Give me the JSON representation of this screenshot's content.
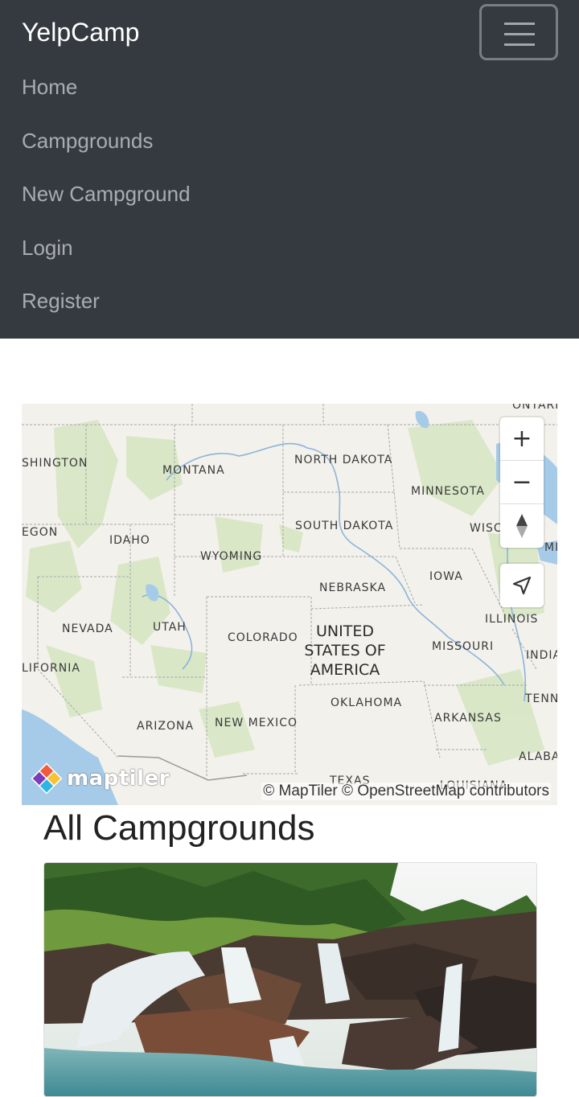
{
  "navbar": {
    "brand": "YelpCamp",
    "links": [
      "Home",
      "Campgrounds",
      "New Campground",
      "Login",
      "Register"
    ]
  },
  "map": {
    "states": {
      "washington": "SHINGTON",
      "montana": "MONTANA",
      "north_dakota": "NORTH DAKOTA",
      "minnesota": "MINNESOTA",
      "oregon": "EGON",
      "idaho": "IDAHO",
      "south_dakota": "SOUTH DAKOTA",
      "wisconsin": "WISC",
      "michigan": "MI",
      "wyoming": "WYOMING",
      "iowa": "IOWA",
      "nebraska": "NEBRASKA",
      "illinois": "ILLINOIS",
      "nevada": "NEVADA",
      "utah": "UTAH",
      "colorado": "COLORADO",
      "missouri": "MISSOURI",
      "indiana": "INDIA",
      "california": "LIFORNIA",
      "oklahoma": "OKLAHOMA",
      "tennessee": "TENN",
      "arkansas": "ARKANSAS",
      "arizona": "ARIZONA",
      "new_mexico": "NEW MEXICO",
      "alabama": "ALABA",
      "texas": "TEXAS",
      "louisiana": "LOUISIANA",
      "ontario": "ONTARIO"
    },
    "country_label": "UNITED STATES OF AMERICA",
    "country_lines": [
      "UNITED",
      "STATES OF",
      "AMERICA"
    ],
    "controls": {
      "zoom_in": "+",
      "zoom_out": "−"
    },
    "logo_text": "maptiler",
    "attribution": "© MapTiler © OpenStreetMap contributors"
  },
  "main": {
    "title": "All Campgrounds"
  },
  "colors": {
    "navbar_bg": "#343a40",
    "water": "#a6cbe8",
    "land": "#f3f1eb",
    "park": "#d7e6c4"
  }
}
